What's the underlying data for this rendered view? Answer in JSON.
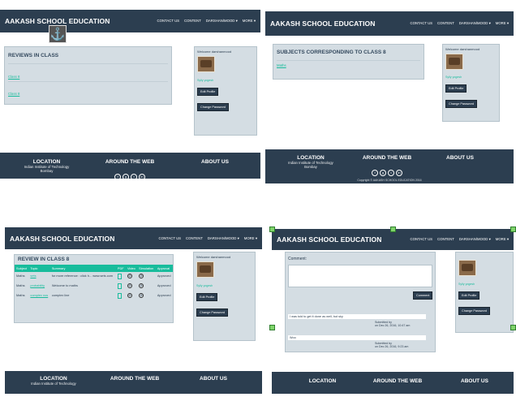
{
  "brand": "AAKASH SCHOOL EDUCATION",
  "menu": [
    "CONTACT US",
    "CONTENT",
    "DARSHAN/MOOD ▾",
    "MORE ▾"
  ],
  "side": {
    "welcome": "Welcome darshanmood",
    "name": "Sylly yogesh",
    "edit": "Edit Profile",
    "change": "Change Password",
    "change_alt": "Change Password"
  },
  "footer": {
    "location": "LOCATION",
    "loc_line1": "Indian Institute of Technology",
    "loc_line2": "Bombay",
    "web": "AROUND THE WEB",
    "about": "ABOUT US",
    "copyright": "Copyright © AAKASH SCHOOL EDUCATION 2016"
  },
  "p1": {
    "title": "REVIEWS IN CLASS",
    "links": [
      "Class 8",
      "Class 8"
    ]
  },
  "p2": {
    "title": "SUBJECTS CORRESPONDING TO CLASS 8",
    "links": [
      "Maths"
    ]
  },
  "p3": {
    "title": "REVIEW IN CLASS 8",
    "headers": [
      "Subject",
      "Topic",
      "Summary",
      "PDF",
      "Video",
      "Simulation",
      "Approval"
    ],
    "rows": [
      [
        "Maths",
        "sets",
        "for more reference : click h... www.sets.com",
        "Approved"
      ],
      [
        "Maths",
        "probability",
        "Welcome to maths",
        "Approved"
      ],
      [
        "Maths",
        "complex nos",
        "complex line",
        "Approved"
      ]
    ]
  },
  "p4": {
    "comment_label": "Comment:",
    "submit": "Comment",
    "comments": [
      {
        "text": "I was told to get it done as well, but sky",
        "by": "Submitted by",
        "date": "on Dec 26, 2016, 10:47 am"
      },
      {
        "text": "Woo",
        "by": "Submitted by",
        "date": "on Dec 26, 2016, 9:23 am"
      }
    ]
  }
}
